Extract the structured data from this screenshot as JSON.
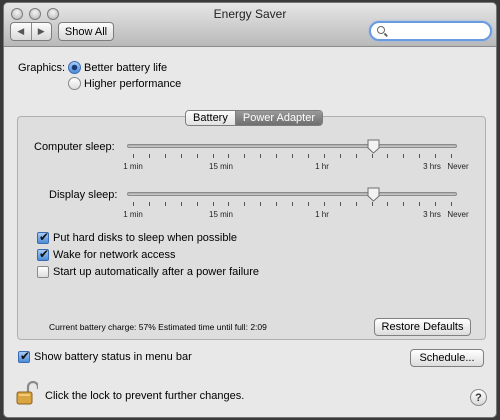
{
  "window": {
    "title": "Energy Saver"
  },
  "toolbar": {
    "back_glyph": "◀",
    "forward_glyph": "▶",
    "show_all_label": "Show All",
    "search_placeholder": ""
  },
  "graphics": {
    "label": "Graphics:",
    "options": [
      {
        "label": "Better battery life",
        "selected": true
      },
      {
        "label": "Higher performance",
        "selected": false
      }
    ]
  },
  "tabs": [
    {
      "label": "Battery",
      "selected": false
    },
    {
      "label": "Power Adapter",
      "selected": true
    }
  ],
  "sliders": {
    "computer_sleep": {
      "label": "Computer sleep:",
      "ticks": [
        "1 min",
        "15 min",
        "1 hr",
        "3 hrs",
        "Never"
      ],
      "selected_fraction": 0.745
    },
    "display_sleep": {
      "label": "Display sleep:",
      "ticks": [
        "1 min",
        "15 min",
        "1 hr",
        "3 hrs",
        "Never"
      ],
      "selected_fraction": 0.745
    }
  },
  "options": {
    "hard_disks": {
      "label": "Put hard disks to sleep when possible",
      "checked": true
    },
    "network": {
      "label": "Wake for network access",
      "checked": true
    },
    "startup": {
      "label": "Start up automatically after a power failure",
      "checked": false
    }
  },
  "status": {
    "charge_label": "Current battery charge:",
    "charge_value": "57%",
    "time_label": "Estimated time until full:",
    "time_value": "2:09"
  },
  "buttons": {
    "restore_defaults": "Restore Defaults",
    "schedule": "Schedule..."
  },
  "menu_bar_option": {
    "label": "Show battery status in menu bar",
    "checked": true
  },
  "lock": {
    "text": "Click the lock to prevent further changes.",
    "icon": "unlocked-padlock-icon"
  },
  "help": {
    "label": "?"
  },
  "colors": {
    "accent": "#4d8cd6",
    "tab_selected": "#7a7a7a",
    "search_focus": "#6a9be0"
  }
}
